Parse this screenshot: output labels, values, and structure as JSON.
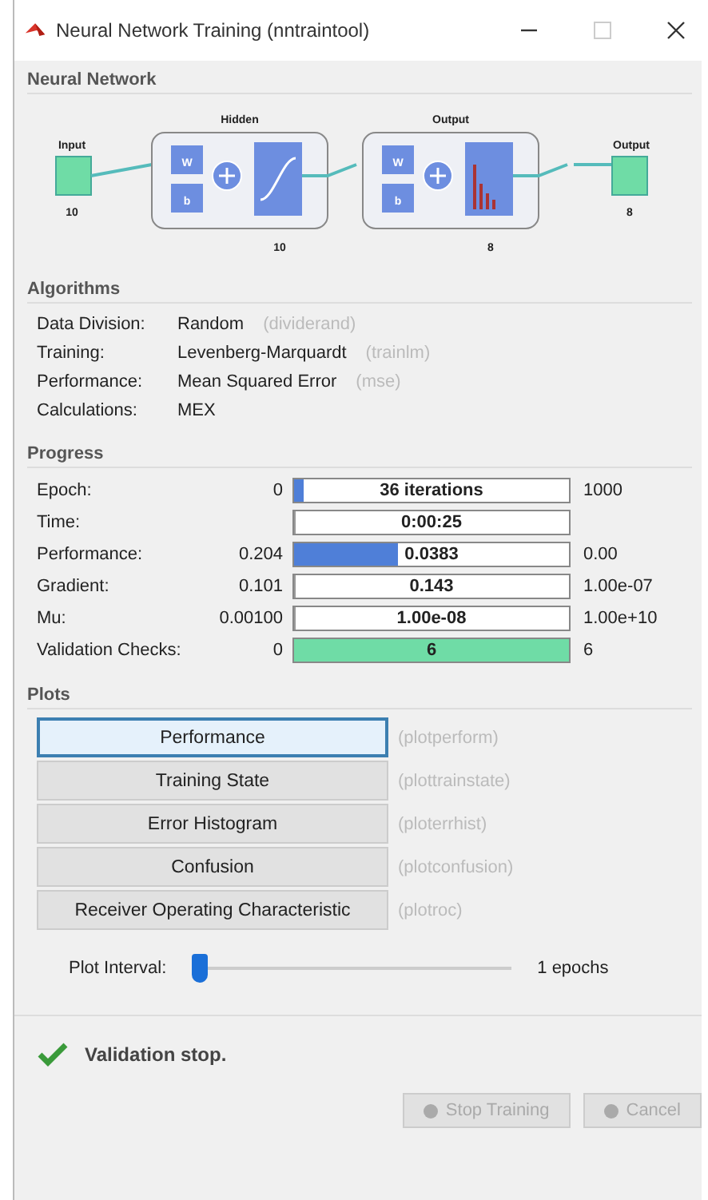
{
  "window": {
    "title": "Neural Network Training (nntraintool)"
  },
  "neural_network": {
    "title": "Neural Network",
    "input": {
      "label": "Input",
      "size": "10"
    },
    "layers": [
      {
        "label": "Hidden",
        "size": "10",
        "kind": "tansig",
        "weight": "W",
        "bias": "b"
      },
      {
        "label": "Output",
        "size": "8",
        "kind": "softmax",
        "weight": "W",
        "bias": "b"
      }
    ],
    "output": {
      "label": "Output",
      "size": "8"
    }
  },
  "algorithms": {
    "title": "Algorithms",
    "rows": [
      {
        "label": "Data Division:",
        "value": "Random",
        "function": "(dividerand)"
      },
      {
        "label": "Training:",
        "value": "Levenberg-Marquardt",
        "function": "(trainlm)"
      },
      {
        "label": "Performance:",
        "value": "Mean Squared Error",
        "function": "(mse)"
      },
      {
        "label": "Calculations:",
        "value": "MEX"
      }
    ]
  },
  "progress": {
    "title": "Progress",
    "rows": [
      {
        "label": "Epoch:",
        "start": "0",
        "bar_text": "36 iterations",
        "level": 0.036,
        "color": "#4f7fd8",
        "end": "1000"
      },
      {
        "label": "Time:",
        "bar_text": "0:00:25",
        "level": 0
      },
      {
        "label": "Performance:",
        "start": "0.204",
        "bar_text": "0.0383",
        "level": 0.38,
        "color": "#4f7fd8",
        "end": "0.00"
      },
      {
        "label": "Gradient:",
        "start": "0.101",
        "bar_text": "0.143",
        "level": 0,
        "end": "1.00e-07"
      },
      {
        "label": "Mu:",
        "start": "0.00100",
        "bar_text": "1.00e-08",
        "level": 0,
        "end": "1.00e+10"
      },
      {
        "label": "Validation Checks:",
        "start": "0",
        "bar_text": "6",
        "level": 1,
        "color": "#6fdca6",
        "end": "6"
      }
    ]
  },
  "plots": {
    "title": "Plots",
    "buttons": [
      {
        "label": "Performance",
        "function": "(plotperform)",
        "selected": true
      },
      {
        "label": "Training State",
        "function": "(plottrainstate)",
        "selected": false
      },
      {
        "label": "Error Histogram",
        "function": "(ploterrhist)",
        "selected": false
      },
      {
        "label": "Confusion",
        "function": "(plotconfusion)",
        "selected": false
      },
      {
        "label": "Receiver Operating Characteristic",
        "function": "(plotroc)",
        "selected": false
      }
    ],
    "interval": {
      "label": "Plot Interval:",
      "level": 0,
      "reading": "1 epochs"
    }
  },
  "status": {
    "text": "Validation stop."
  },
  "buttons": [
    {
      "label": "Stop Training",
      "disabled": true
    },
    {
      "label": "Cancel",
      "disabled": true
    }
  ]
}
